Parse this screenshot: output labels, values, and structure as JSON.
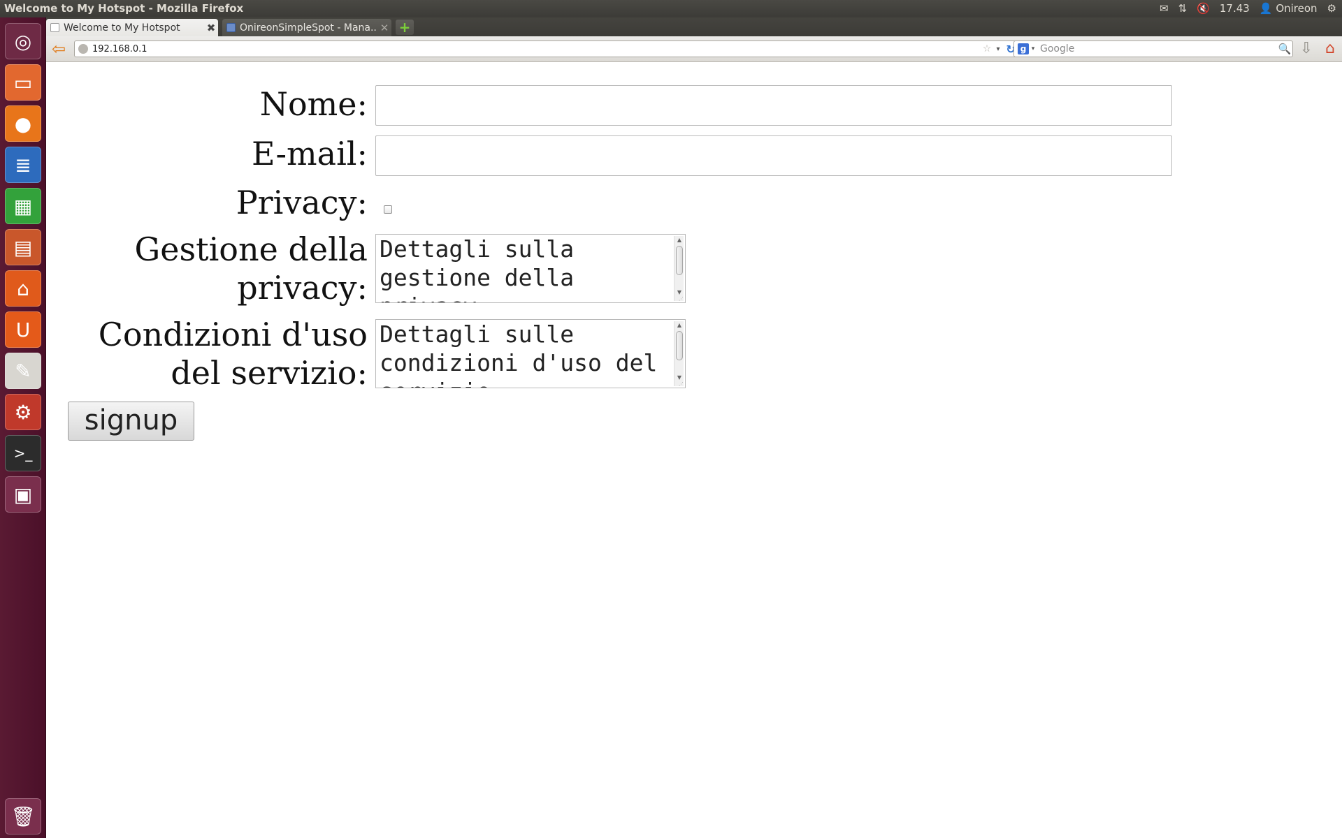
{
  "window": {
    "title": "Welcome to My Hotspot - Mozilla Firefox"
  },
  "indicators": {
    "clock": "17.43",
    "user": "Onireon"
  },
  "tabs": [
    {
      "label": "Welcome to My Hotspot",
      "active": true
    },
    {
      "label": "OnireonSimpleSpot - Mana...",
      "active": false
    }
  ],
  "navbar": {
    "url": "192.168.0.1",
    "search_placeholder": "Google",
    "search_engine_letter": "g"
  },
  "launcher": {
    "items": [
      {
        "name": "dash-home-icon",
        "glyph": "◎",
        "color": "#6e2a45"
      },
      {
        "name": "files-icon",
        "glyph": "▭",
        "color": "#e2682f"
      },
      {
        "name": "firefox-icon",
        "glyph": "●",
        "color": "#e8751a"
      },
      {
        "name": "libreoffice-writer-icon",
        "glyph": "≣",
        "color": "#2d6bbd"
      },
      {
        "name": "libreoffice-calc-icon",
        "glyph": "▦",
        "color": "#33a23b"
      },
      {
        "name": "libreoffice-impress-icon",
        "glyph": "▤",
        "color": "#c9572b"
      },
      {
        "name": "software-center-icon",
        "glyph": "⌂",
        "color": "#e05a1b"
      },
      {
        "name": "ubuntu-one-icon",
        "glyph": "U",
        "color": "#e45a1a"
      },
      {
        "name": "text-editor-icon",
        "glyph": "✎",
        "color": "#d8d6d0"
      },
      {
        "name": "system-settings-icon",
        "glyph": "⚙",
        "color": "#c0392b"
      },
      {
        "name": "terminal-icon",
        "glyph": ">_",
        "color": "#2c2c2c"
      },
      {
        "name": "workspace-switcher-icon",
        "glyph": "▣",
        "color": "#7a2f4d"
      }
    ],
    "trash": {
      "name": "trash-icon",
      "glyph": "🗑",
      "color": "#7a2f4d"
    }
  },
  "form": {
    "name_label": "Nome:",
    "name_value": "",
    "email_label": "E-mail:",
    "email_value": "",
    "privacy_label": "Privacy:",
    "privacy_checked": false,
    "privacy_mgmt_label_line1": "Gestione della",
    "privacy_mgmt_label_line2": "privacy:",
    "privacy_mgmt_text": "Dettagli sulla gestione della privacy",
    "terms_label_line1": "Condizioni d'uso",
    "terms_label_line2": "del servizio:",
    "terms_text": "Dettagli sulle condizioni d'uso del servizio",
    "signup_label": "signup"
  },
  "colors": {
    "launcher_bg": "#4b1029",
    "topbar_bg": "#3c3b37",
    "accent_orange": "#e07b1a"
  }
}
